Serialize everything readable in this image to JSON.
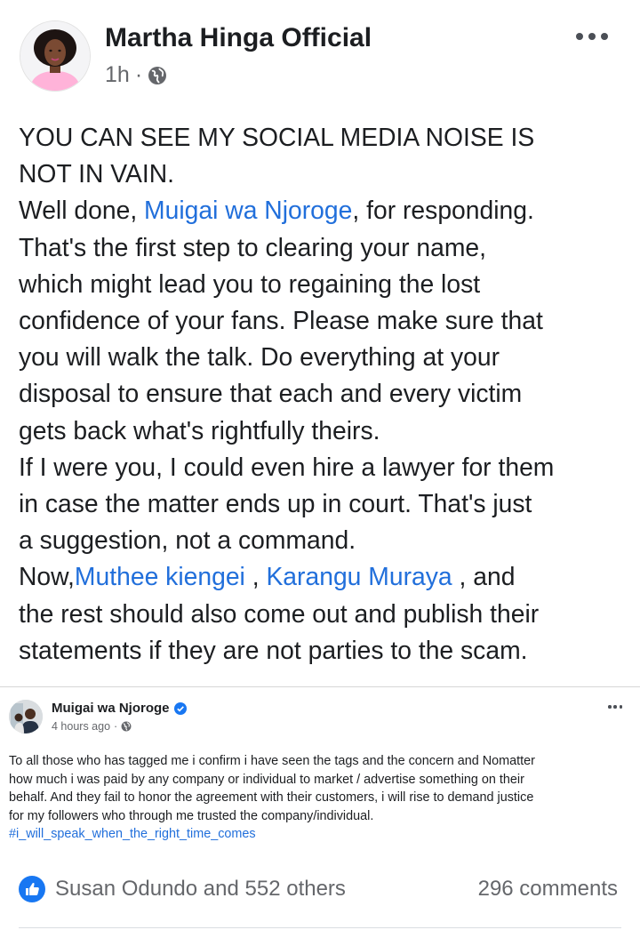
{
  "post": {
    "author": "Martha Hinga Official",
    "time": "1h",
    "separator": "·",
    "privacy_icon": "globe-icon",
    "more_icon": "more-options-icon",
    "lines": [
      [
        {
          "t": "YOU CAN SEE MY SOCIAL MEDIA NOISE IS"
        }
      ],
      [
        {
          "t": "NOT IN VAIN."
        }
      ],
      [
        {
          "t": "Well done, "
        },
        {
          "t": "Muigai wa Njoroge",
          "link": true
        },
        {
          "t": ", for responding."
        }
      ],
      [
        {
          "t": "That's the first step to clearing your name,"
        }
      ],
      [
        {
          "t": "which might lead you to regaining the lost"
        }
      ],
      [
        {
          "t": "confidence of your fans. Please make sure that"
        }
      ],
      [
        {
          "t": "you will walk the talk. Do everything at your"
        }
      ],
      [
        {
          "t": "disposal to ensure that each and every victim"
        }
      ],
      [
        {
          "t": "gets back what's rightfully theirs."
        }
      ],
      [
        {
          "t": "If I were you, I could even hire a lawyer for them"
        }
      ],
      [
        {
          "t": "in case the matter ends up in court. That's just"
        }
      ],
      [
        {
          "t": "a suggestion, not a command."
        }
      ],
      [
        {
          "t": "Now,"
        },
        {
          "t": "Muthee kiengei",
          "link": true
        },
        {
          "t": "  , "
        },
        {
          "t": "Karangu Muraya",
          "link": true
        },
        {
          "t": " , and"
        }
      ],
      [
        {
          "t": "the rest should also come out and publish their"
        }
      ],
      [
        {
          "t": "statements if they are not parties to the scam."
        }
      ]
    ]
  },
  "shared_post": {
    "author": "Muigai wa Njoroge",
    "verified_icon": "verified-badge-icon",
    "time": "4 hours ago",
    "separator": "·",
    "privacy_icon": "globe-icon",
    "more_icon": "more-options-icon",
    "lines": [
      [
        {
          "t": "To all those who has tagged me i confirm i have seen the tags and the concern and Nomatter"
        }
      ],
      [
        {
          "t": "how much i was paid by any company or individual to market / advertise something on their"
        }
      ],
      [
        {
          "t": "behalf. And they fail to honor the agreement with their customers,  i will rise to demand justice"
        }
      ],
      [
        {
          "t": "for my followers who through me trusted the company/individual."
        }
      ],
      [
        {
          "t": "#i_will_speak_when_the_right_time_comes",
          "link": true
        }
      ]
    ]
  },
  "reactions": {
    "icon": "like-icon",
    "summary": "Susan Odundo and 552 others",
    "comments": "296 comments"
  },
  "colors": {
    "link": "#216fdb",
    "text": "#1c1e21",
    "secondary": "#65676b",
    "like_blue": "#1877f2"
  }
}
